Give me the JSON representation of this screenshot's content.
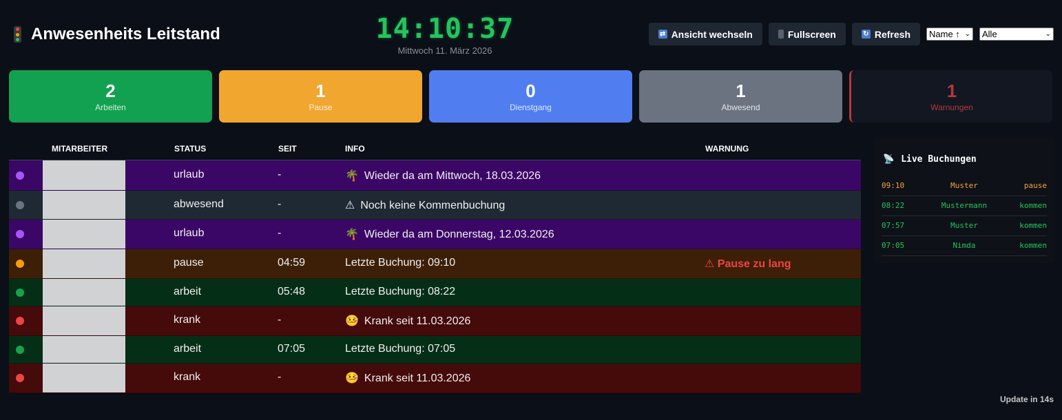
{
  "header": {
    "title": "Anwesenheits Leitstand",
    "clock_time": "14:10:37",
    "clock_date": "Mittwoch 11. März 2026",
    "buttons": {
      "switch_view": "Ansicht wechseln",
      "fullscreen": "Fullscreen",
      "refresh": "Refresh"
    },
    "sort_select": "Name ↑",
    "filter_select": "Alle"
  },
  "cards": [
    {
      "value": "2",
      "label": "Arbeiten",
      "color": "#12a150"
    },
    {
      "value": "1",
      "label": "Pause",
      "color": "#f1a630"
    },
    {
      "value": "0",
      "label": "Dienstgang",
      "color": "#507ef0"
    },
    {
      "value": "1",
      "label": "Abwesend",
      "color": "#6b7280"
    },
    {
      "value": "1",
      "label": "Warnungen",
      "color": "#b33a3a"
    }
  ],
  "table": {
    "columns": [
      "MITARBEITER",
      "STATUS",
      "SEIT",
      "INFO",
      "WARNUNG"
    ],
    "rows": [
      {
        "status": "urlaub",
        "since": "-",
        "info_icon": "🌴",
        "info": "Wieder da am Mittwoch, 18.03.2026",
        "warning": "",
        "bg": "#3b0766",
        "dot": "#a855f7"
      },
      {
        "status": "abwesend",
        "since": "-",
        "info_icon": "⚠",
        "info": "Noch keine Kommenbuchung",
        "warning": "",
        "bg": "#1f2933",
        "dot": "#6b7280"
      },
      {
        "status": "urlaub",
        "since": "-",
        "info_icon": "🌴",
        "info": "Wieder da am Donnerstag, 12.03.2026",
        "warning": "",
        "bg": "#3b0766",
        "dot": "#a855f7"
      },
      {
        "status": "pause",
        "since": "04:59",
        "info_icon": "",
        "info": "Letzte Buchung: 09:10",
        "warning": "⚠ Pause zu lang",
        "bg": "#3d1f07",
        "dot": "#f59e0b"
      },
      {
        "status": "arbeit",
        "since": "05:48",
        "info_icon": "",
        "info": "Letzte Buchung: 08:22",
        "warning": "",
        "bg": "#052e16",
        "dot": "#16a34a"
      },
      {
        "status": "krank",
        "since": "-",
        "info_icon": "🤒",
        "info": "Krank seit 11.03.2026",
        "warning": "",
        "bg": "#450a0a",
        "dot": "#ef4444"
      },
      {
        "status": "arbeit",
        "since": "07:05",
        "info_icon": "",
        "info": "Letzte Buchung: 07:05",
        "warning": "",
        "bg": "#052e16",
        "dot": "#16a34a"
      },
      {
        "status": "krank",
        "since": "-",
        "info_icon": "🤒",
        "info": "Krank seit 11.03.2026",
        "warning": "",
        "bg": "#450a0a",
        "dot": "#ef4444"
      }
    ]
  },
  "live": {
    "title": "Live Buchungen",
    "entries": [
      {
        "time": "09:10",
        "name": "Muster",
        "type": "pause",
        "color": "#f5a13a"
      },
      {
        "time": "08:22",
        "name": "Mustermann",
        "type": "kommen",
        "color": "#22c55e"
      },
      {
        "time": "07:57",
        "name": "Muster",
        "type": "kommen",
        "color": "#22c55e"
      },
      {
        "time": "07:05",
        "name": "Nimda",
        "type": "kommen",
        "color": "#22c55e"
      }
    ]
  },
  "footer": {
    "update": "Update in 14s"
  }
}
